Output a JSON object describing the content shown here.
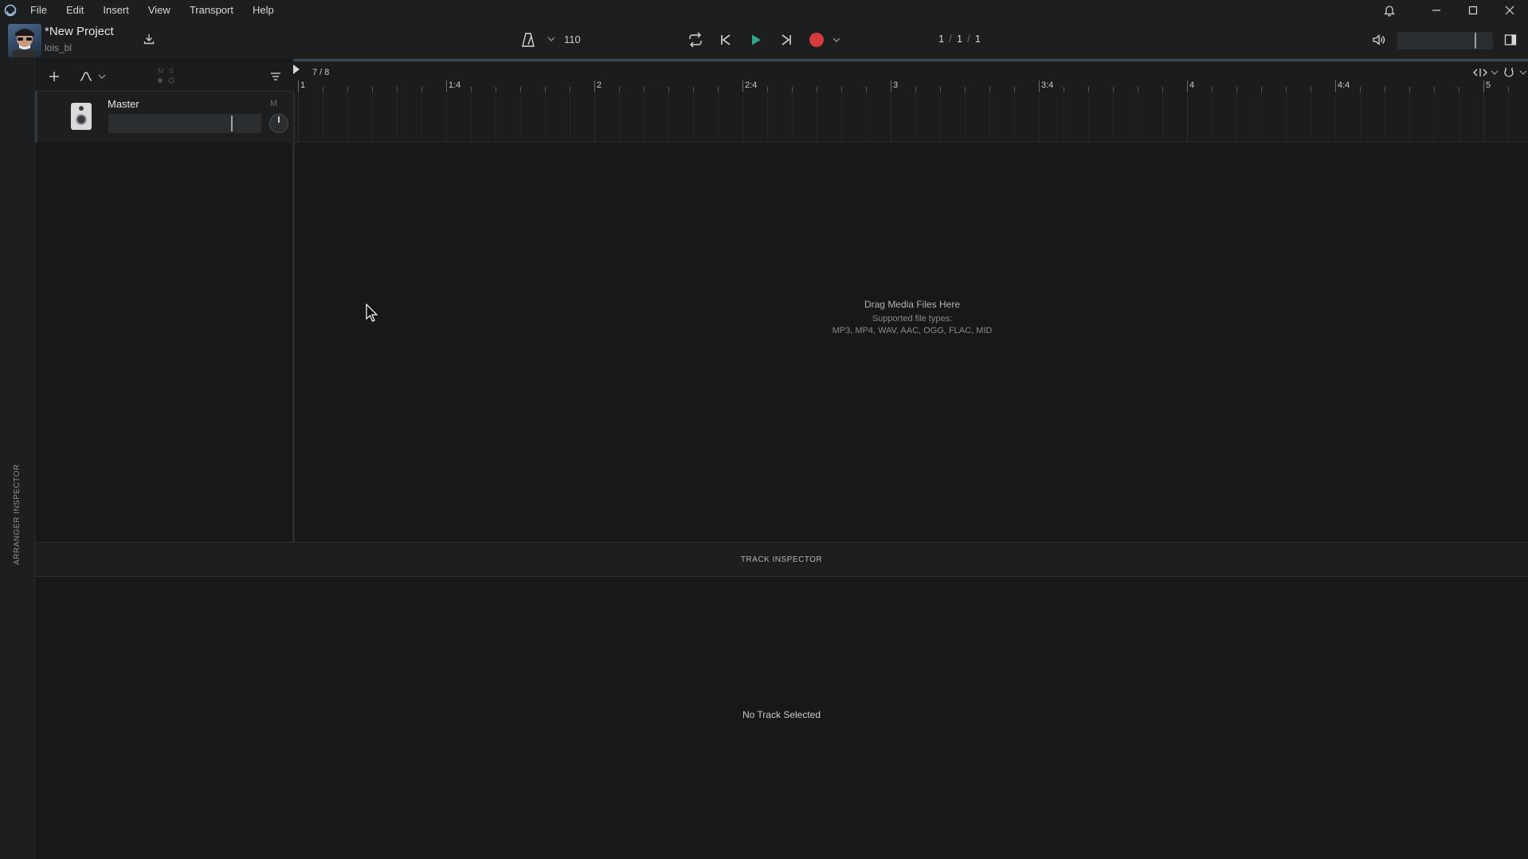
{
  "menubar": {
    "items": [
      "File",
      "Edit",
      "Insert",
      "View",
      "Transport",
      "Help"
    ]
  },
  "toolbar": {
    "project_title": "*New Project",
    "user": "lois_bl",
    "tempo": "110",
    "position": {
      "bar": "1",
      "beat": "1",
      "tick": "1",
      "separator": "/"
    },
    "master_volume_level": 0.8
  },
  "ruler": {
    "time_signature": "7 / 8",
    "labels": [
      "1",
      "1:4",
      "2",
      "2:4",
      "3",
      "3:4",
      "4",
      "4:4",
      "5"
    ]
  },
  "tracks": {
    "master": {
      "name": "Master",
      "mute_label": "M",
      "mini_m": "M",
      "mini_s": "S"
    }
  },
  "arranger": {
    "drop_title": "Drag Media Files Here",
    "drop_sub1": "Supported file types:",
    "drop_sub2": "MP3, MP4, WAV, AAC, OGG, FLAC, MID"
  },
  "left_strip": {
    "label": "ARRANGER INSPECTOR"
  },
  "inspector": {
    "title": "TRACK INSPECTOR",
    "empty_text": "No Track Selected"
  },
  "colors": {
    "play": "#2fa58a",
    "record": "#d63b3b",
    "background": "#161819",
    "panel": "#1c1e20"
  }
}
